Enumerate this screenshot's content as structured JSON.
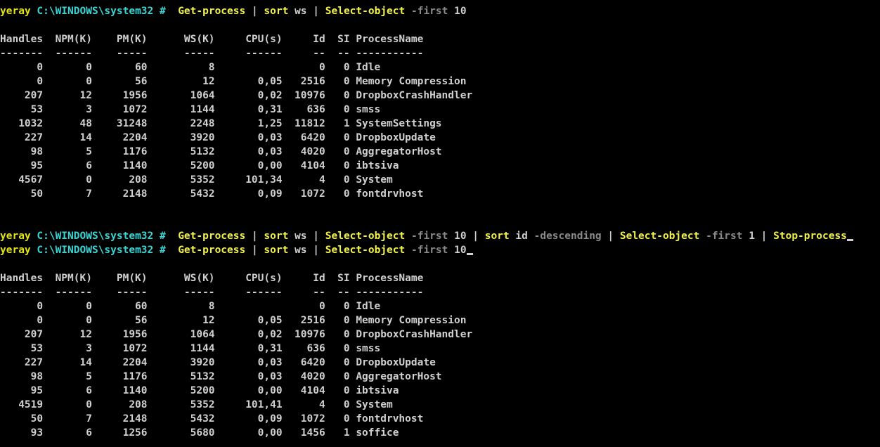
{
  "colors": {
    "background": "#000000",
    "prompt_user": "#e5e510",
    "prompt_path": "#3ad6d6",
    "cmdlet": "#f2f24a",
    "argument": "#d0d0d0",
    "parameter": "#8a8a8a",
    "text": "#d0d0d0"
  },
  "prompt": {
    "user": "yeray",
    "path": "C:\\WINDOWS\\system32 #"
  },
  "commands": [
    {
      "parts": [
        {
          "text": "Get-process",
          "type": "cmd"
        },
        {
          "text": " | ",
          "type": "txt"
        },
        {
          "text": "sort",
          "type": "cmd"
        },
        {
          "text": " ws",
          "type": "arg"
        },
        {
          "text": " | ",
          "type": "txt"
        },
        {
          "text": "Select-object",
          "type": "cmd"
        },
        {
          "text": " -first",
          "type": "param"
        },
        {
          "text": " 10",
          "type": "arg"
        }
      ]
    },
    {
      "parts": [
        {
          "text": "Get-process",
          "type": "cmd"
        },
        {
          "text": " | ",
          "type": "txt"
        },
        {
          "text": "sort",
          "type": "cmd"
        },
        {
          "text": " ws",
          "type": "arg"
        },
        {
          "text": " | ",
          "type": "txt"
        },
        {
          "text": "Select-object",
          "type": "cmd"
        },
        {
          "text": " -first",
          "type": "param"
        },
        {
          "text": " 10",
          "type": "arg"
        },
        {
          "text": " | ",
          "type": "txt"
        },
        {
          "text": "sort",
          "type": "cmd"
        },
        {
          "text": " id",
          "type": "arg"
        },
        {
          "text": " -descending",
          "type": "param"
        },
        {
          "text": " | ",
          "type": "txt"
        },
        {
          "text": "Select-object",
          "type": "cmd"
        },
        {
          "text": " -first",
          "type": "param"
        },
        {
          "text": " 1",
          "type": "arg"
        },
        {
          "text": " | ",
          "type": "txt"
        },
        {
          "text": "Stop-process",
          "type": "cmd"
        }
      ]
    },
    {
      "parts": [
        {
          "text": "Get-process",
          "type": "cmd"
        },
        {
          "text": " | ",
          "type": "txt"
        },
        {
          "text": "sort",
          "type": "cmd"
        },
        {
          "text": " ws",
          "type": "arg"
        },
        {
          "text": " | ",
          "type": "txt"
        },
        {
          "text": "Select-object",
          "type": "cmd"
        },
        {
          "text": " -first",
          "type": "param"
        },
        {
          "text": " 10",
          "type": "arg"
        }
      ]
    }
  ],
  "table_headers": [
    "Handles",
    "NPM(K)",
    "PM(K)",
    "WS(K)",
    "CPU(s)",
    "Id",
    "SI",
    "ProcessName"
  ],
  "table_underlines": [
    "-------",
    "------",
    "-----",
    "-----",
    "------",
    "--",
    "--",
    "-----------"
  ],
  "table1_rows": [
    [
      "0",
      "0",
      "60",
      "8",
      "",
      "0",
      "0",
      "Idle"
    ],
    [
      "0",
      "0",
      "56",
      "12",
      "0,05",
      "2516",
      "0",
      "Memory Compression"
    ],
    [
      "207",
      "12",
      "1956",
      "1064",
      "0,02",
      "10976",
      "0",
      "DropboxCrashHandler"
    ],
    [
      "53",
      "3",
      "1072",
      "1144",
      "0,31",
      "636",
      "0",
      "smss"
    ],
    [
      "1032",
      "48",
      "31248",
      "2248",
      "1,25",
      "11812",
      "1",
      "SystemSettings"
    ],
    [
      "227",
      "14",
      "2204",
      "3920",
      "0,03",
      "6420",
      "0",
      "DropboxUpdate"
    ],
    [
      "98",
      "5",
      "1176",
      "5132",
      "0,03",
      "4020",
      "0",
      "AggregatorHost"
    ],
    [
      "95",
      "6",
      "1140",
      "5200",
      "0,00",
      "4104",
      "0",
      "ibtsiva"
    ],
    [
      "4567",
      "0",
      "208",
      "5352",
      "101,34",
      "4",
      "0",
      "System"
    ],
    [
      "50",
      "7",
      "2148",
      "5432",
      "0,09",
      "1072",
      "0",
      "fontdrvhost"
    ]
  ],
  "table2_rows": [
    [
      "0",
      "0",
      "60",
      "8",
      "",
      "0",
      "0",
      "Idle"
    ],
    [
      "0",
      "0",
      "56",
      "12",
      "0,05",
      "2516",
      "0",
      "Memory Compression"
    ],
    [
      "207",
      "12",
      "1956",
      "1064",
      "0,02",
      "10976",
      "0",
      "DropboxCrashHandler"
    ],
    [
      "53",
      "3",
      "1072",
      "1144",
      "0,31",
      "636",
      "0",
      "smss"
    ],
    [
      "227",
      "14",
      "2204",
      "3920",
      "0,03",
      "6420",
      "0",
      "DropboxUpdate"
    ],
    [
      "98",
      "5",
      "1176",
      "5132",
      "0,03",
      "4020",
      "0",
      "AggregatorHost"
    ],
    [
      "95",
      "6",
      "1140",
      "5200",
      "0,00",
      "4104",
      "0",
      "ibtsiva"
    ],
    [
      "4519",
      "0",
      "208",
      "5352",
      "101,41",
      "4",
      "0",
      "System"
    ],
    [
      "50",
      "7",
      "2148",
      "5432",
      "0,09",
      "1072",
      "0",
      "fontdrvhost"
    ],
    [
      "93",
      "6",
      "1256",
      "5680",
      "0,00",
      "1456",
      "1",
      "soffice"
    ]
  ]
}
